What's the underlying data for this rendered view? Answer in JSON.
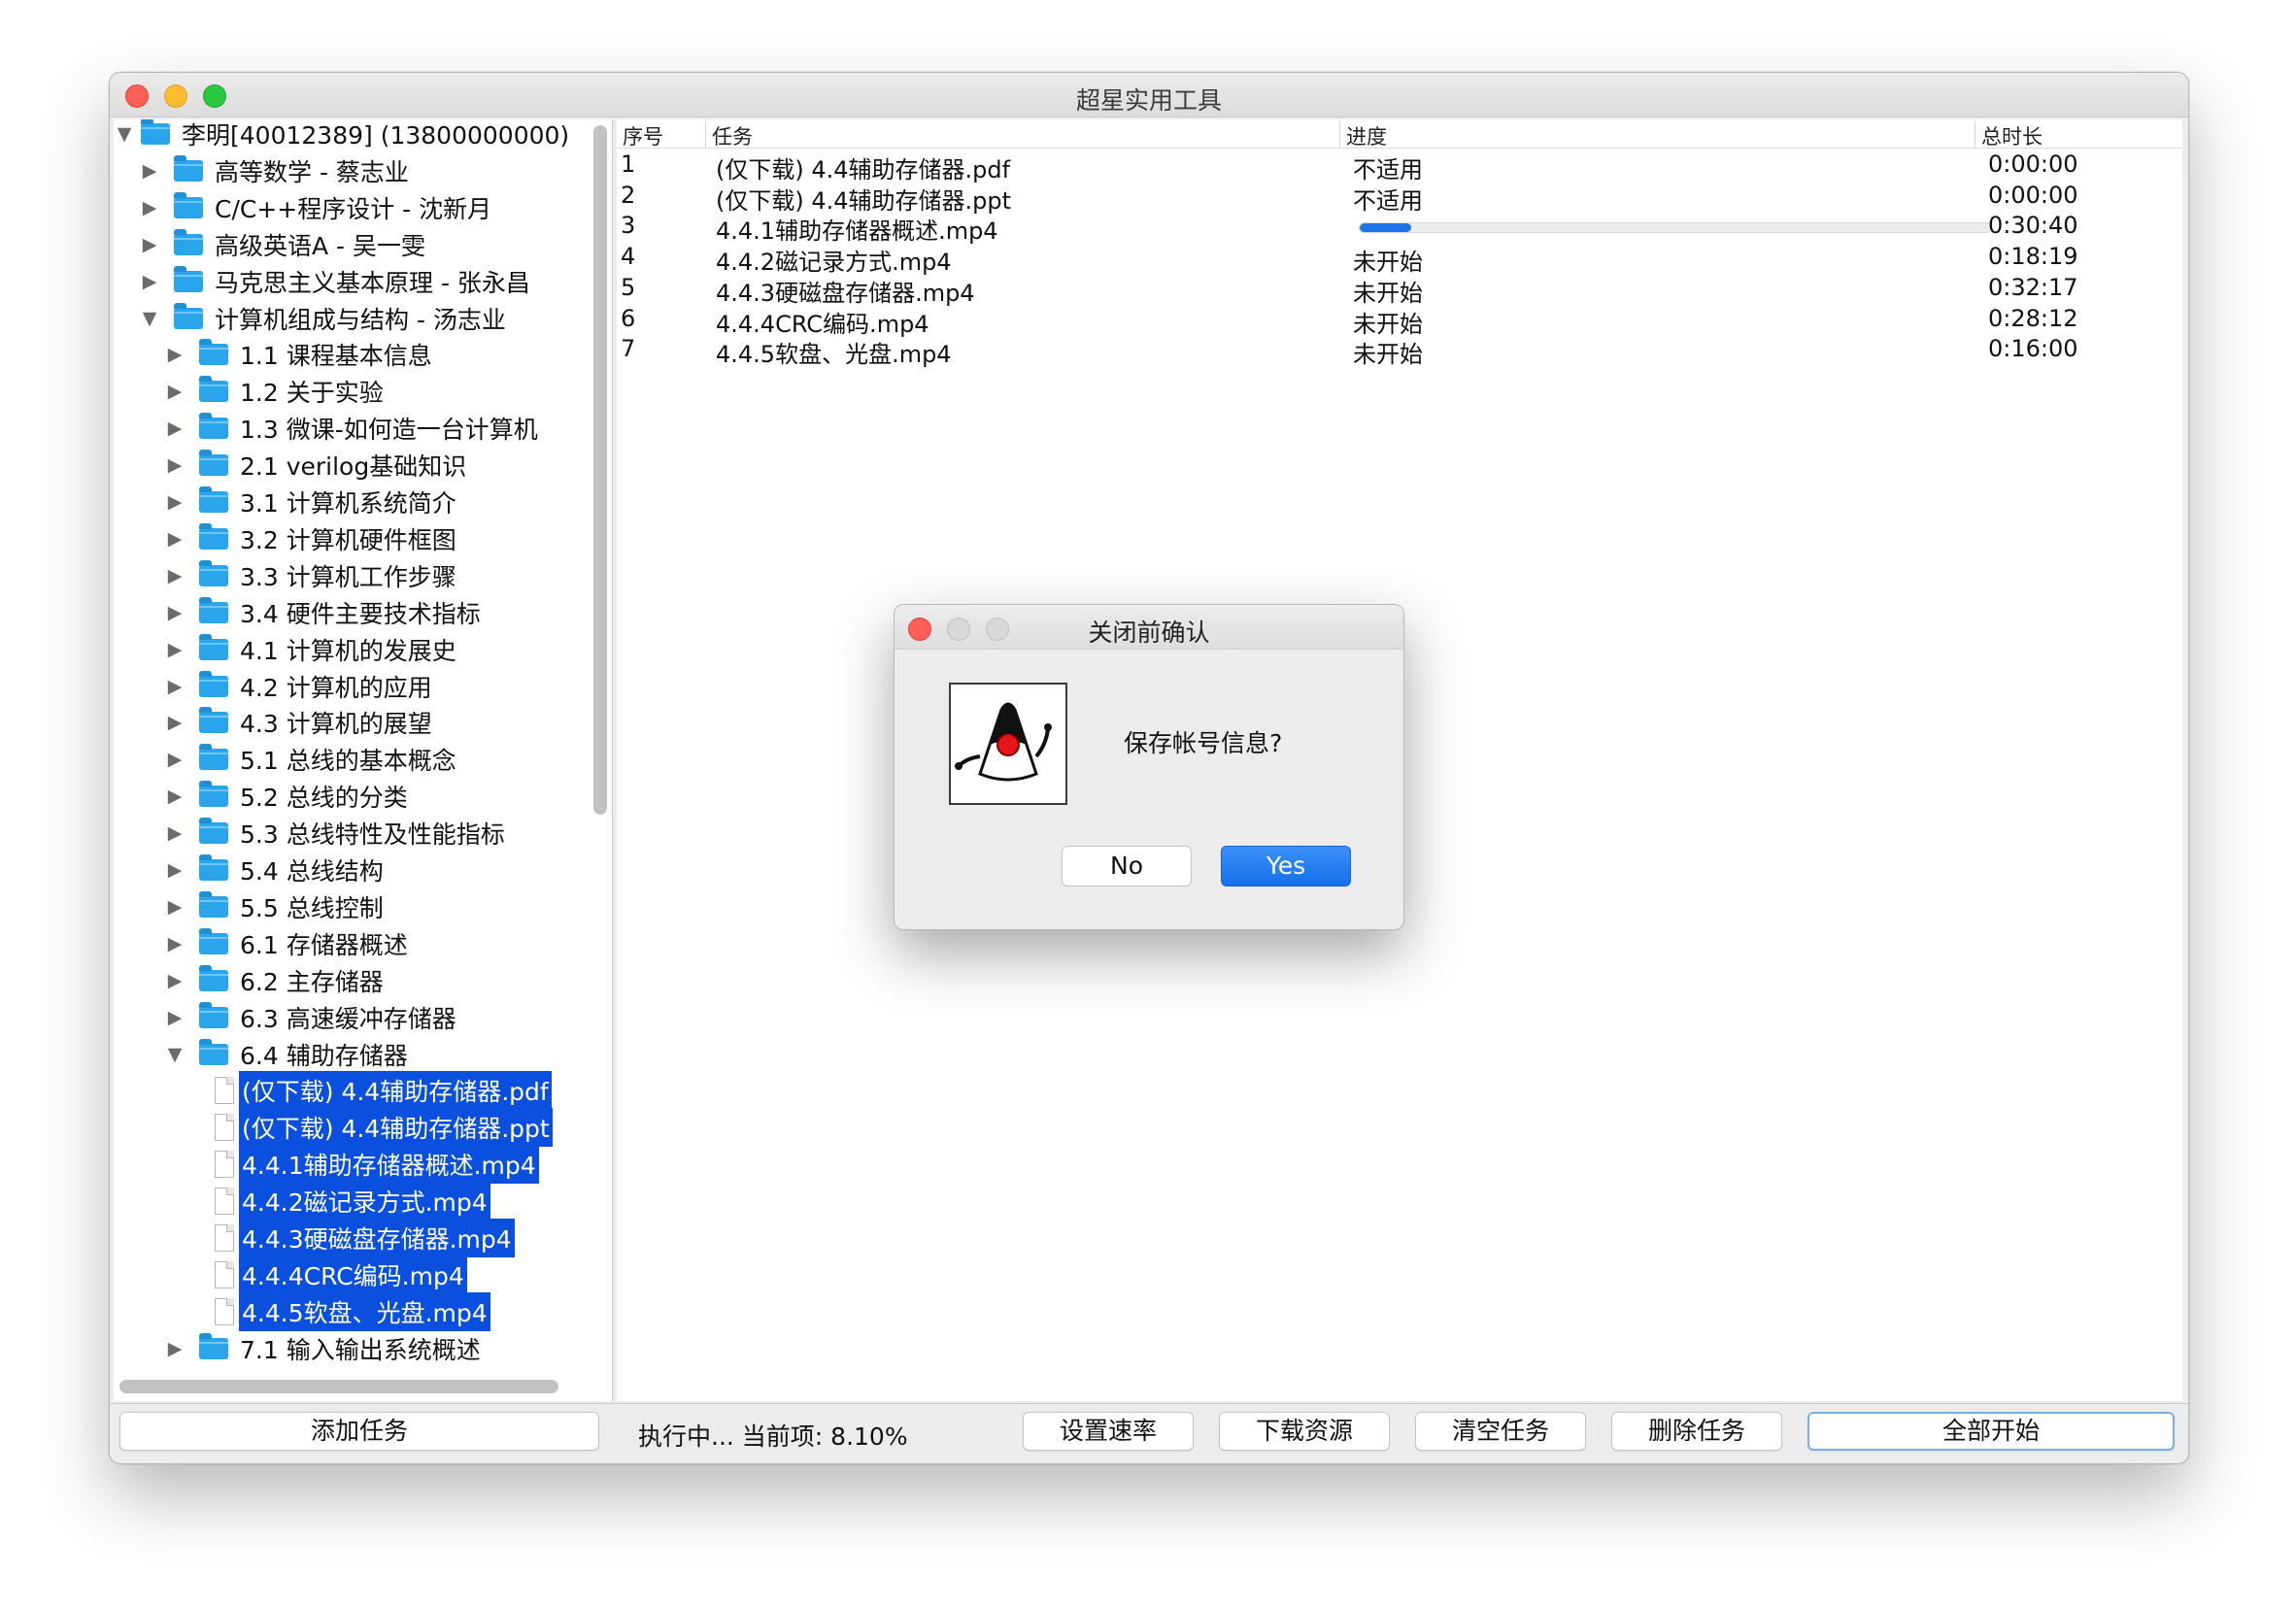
{
  "window": {
    "title": "超星实用工具"
  },
  "tree": {
    "root": "李明[40012389] (13800000000)",
    "courses": [
      "高等数学 - 蔡志业",
      "C/C++程序设计 - 沈新月",
      "高级英语A - 吴一雯",
      "马克思主义基本原理 - 张永昌",
      "计算机组成与结构 - 汤志业"
    ],
    "chapters": [
      "1.1 课程基本信息",
      "1.2 关于实验",
      "1.3 微课-如何造一台计算机",
      "2.1 verilog基础知识",
      "3.1 计算机系统简介",
      "3.2 计算机硬件框图",
      "3.3 计算机工作步骤",
      "3.4 硬件主要技术指标",
      "4.1 计算机的发展史",
      "4.2 计算机的应用",
      "4.3 计算机的展望",
      "5.1 总线的基本概念",
      "5.2 总线的分类",
      "5.3 总线特性及性能指标",
      "5.4 总线结构",
      "5.5 总线控制",
      "6.1 存储器概述",
      "6.2 主存储器",
      "6.3 高速缓冲存储器",
      "6.4 辅助存储器"
    ],
    "files": [
      "(仅下载) 4.4辅助存储器.pdf",
      "(仅下载) 4.4辅助存储器.ppt",
      "4.4.1辅助存储器概述.mp4",
      "4.4.2磁记录方式.mp4",
      "4.4.3硬磁盘存储器.mp4",
      "4.4.4CRC编码.mp4",
      "4.4.5软盘、光盘.mp4"
    ],
    "last_chapter": "7.1 输入输出系统概述"
  },
  "table": {
    "headers": {
      "index": "序号",
      "task": "任务",
      "progress": "进度",
      "duration": "总时长"
    },
    "rows": [
      {
        "index": "1",
        "task": "(仅下载) 4.4辅助存储器.pdf",
        "progress_text": "不适用",
        "duration": "0:00:00"
      },
      {
        "index": "2",
        "task": "(仅下载) 4.4辅助存储器.ppt",
        "progress_text": "不适用",
        "duration": "0:00:00"
      },
      {
        "index": "3",
        "task": "4.4.1辅助存储器概述.mp4",
        "progress_fraction": 0.081,
        "duration": "0:30:40"
      },
      {
        "index": "4",
        "task": "4.4.2磁记录方式.mp4",
        "progress_text": "未开始",
        "duration": "0:18:19"
      },
      {
        "index": "5",
        "task": "4.4.3硬磁盘存储器.mp4",
        "progress_text": "未开始",
        "duration": "0:32:17"
      },
      {
        "index": "6",
        "task": "4.4.4CRC编码.mp4",
        "progress_text": "未开始",
        "duration": "0:28:12"
      },
      {
        "index": "7",
        "task": "4.4.5软盘、光盘.mp4",
        "progress_text": "未开始",
        "duration": "0:16:00"
      }
    ]
  },
  "toolbar": {
    "add_task": "添加任务",
    "status": "执行中... 当前项: 8.10%",
    "set_rate": "设置速率",
    "download_resources": "下载资源",
    "clear_tasks": "清空任务",
    "delete_task": "删除任务",
    "start_all": "全部开始"
  },
  "dialog": {
    "title": "关闭前确认",
    "message": "保存帐号信息?",
    "no_label": "No",
    "yes_label": "Yes"
  },
  "colors": {
    "selection": "#0a4fdd",
    "folder": "#2aa4ea",
    "progress": "#1e74e6",
    "primary_button": "#1470ec"
  }
}
